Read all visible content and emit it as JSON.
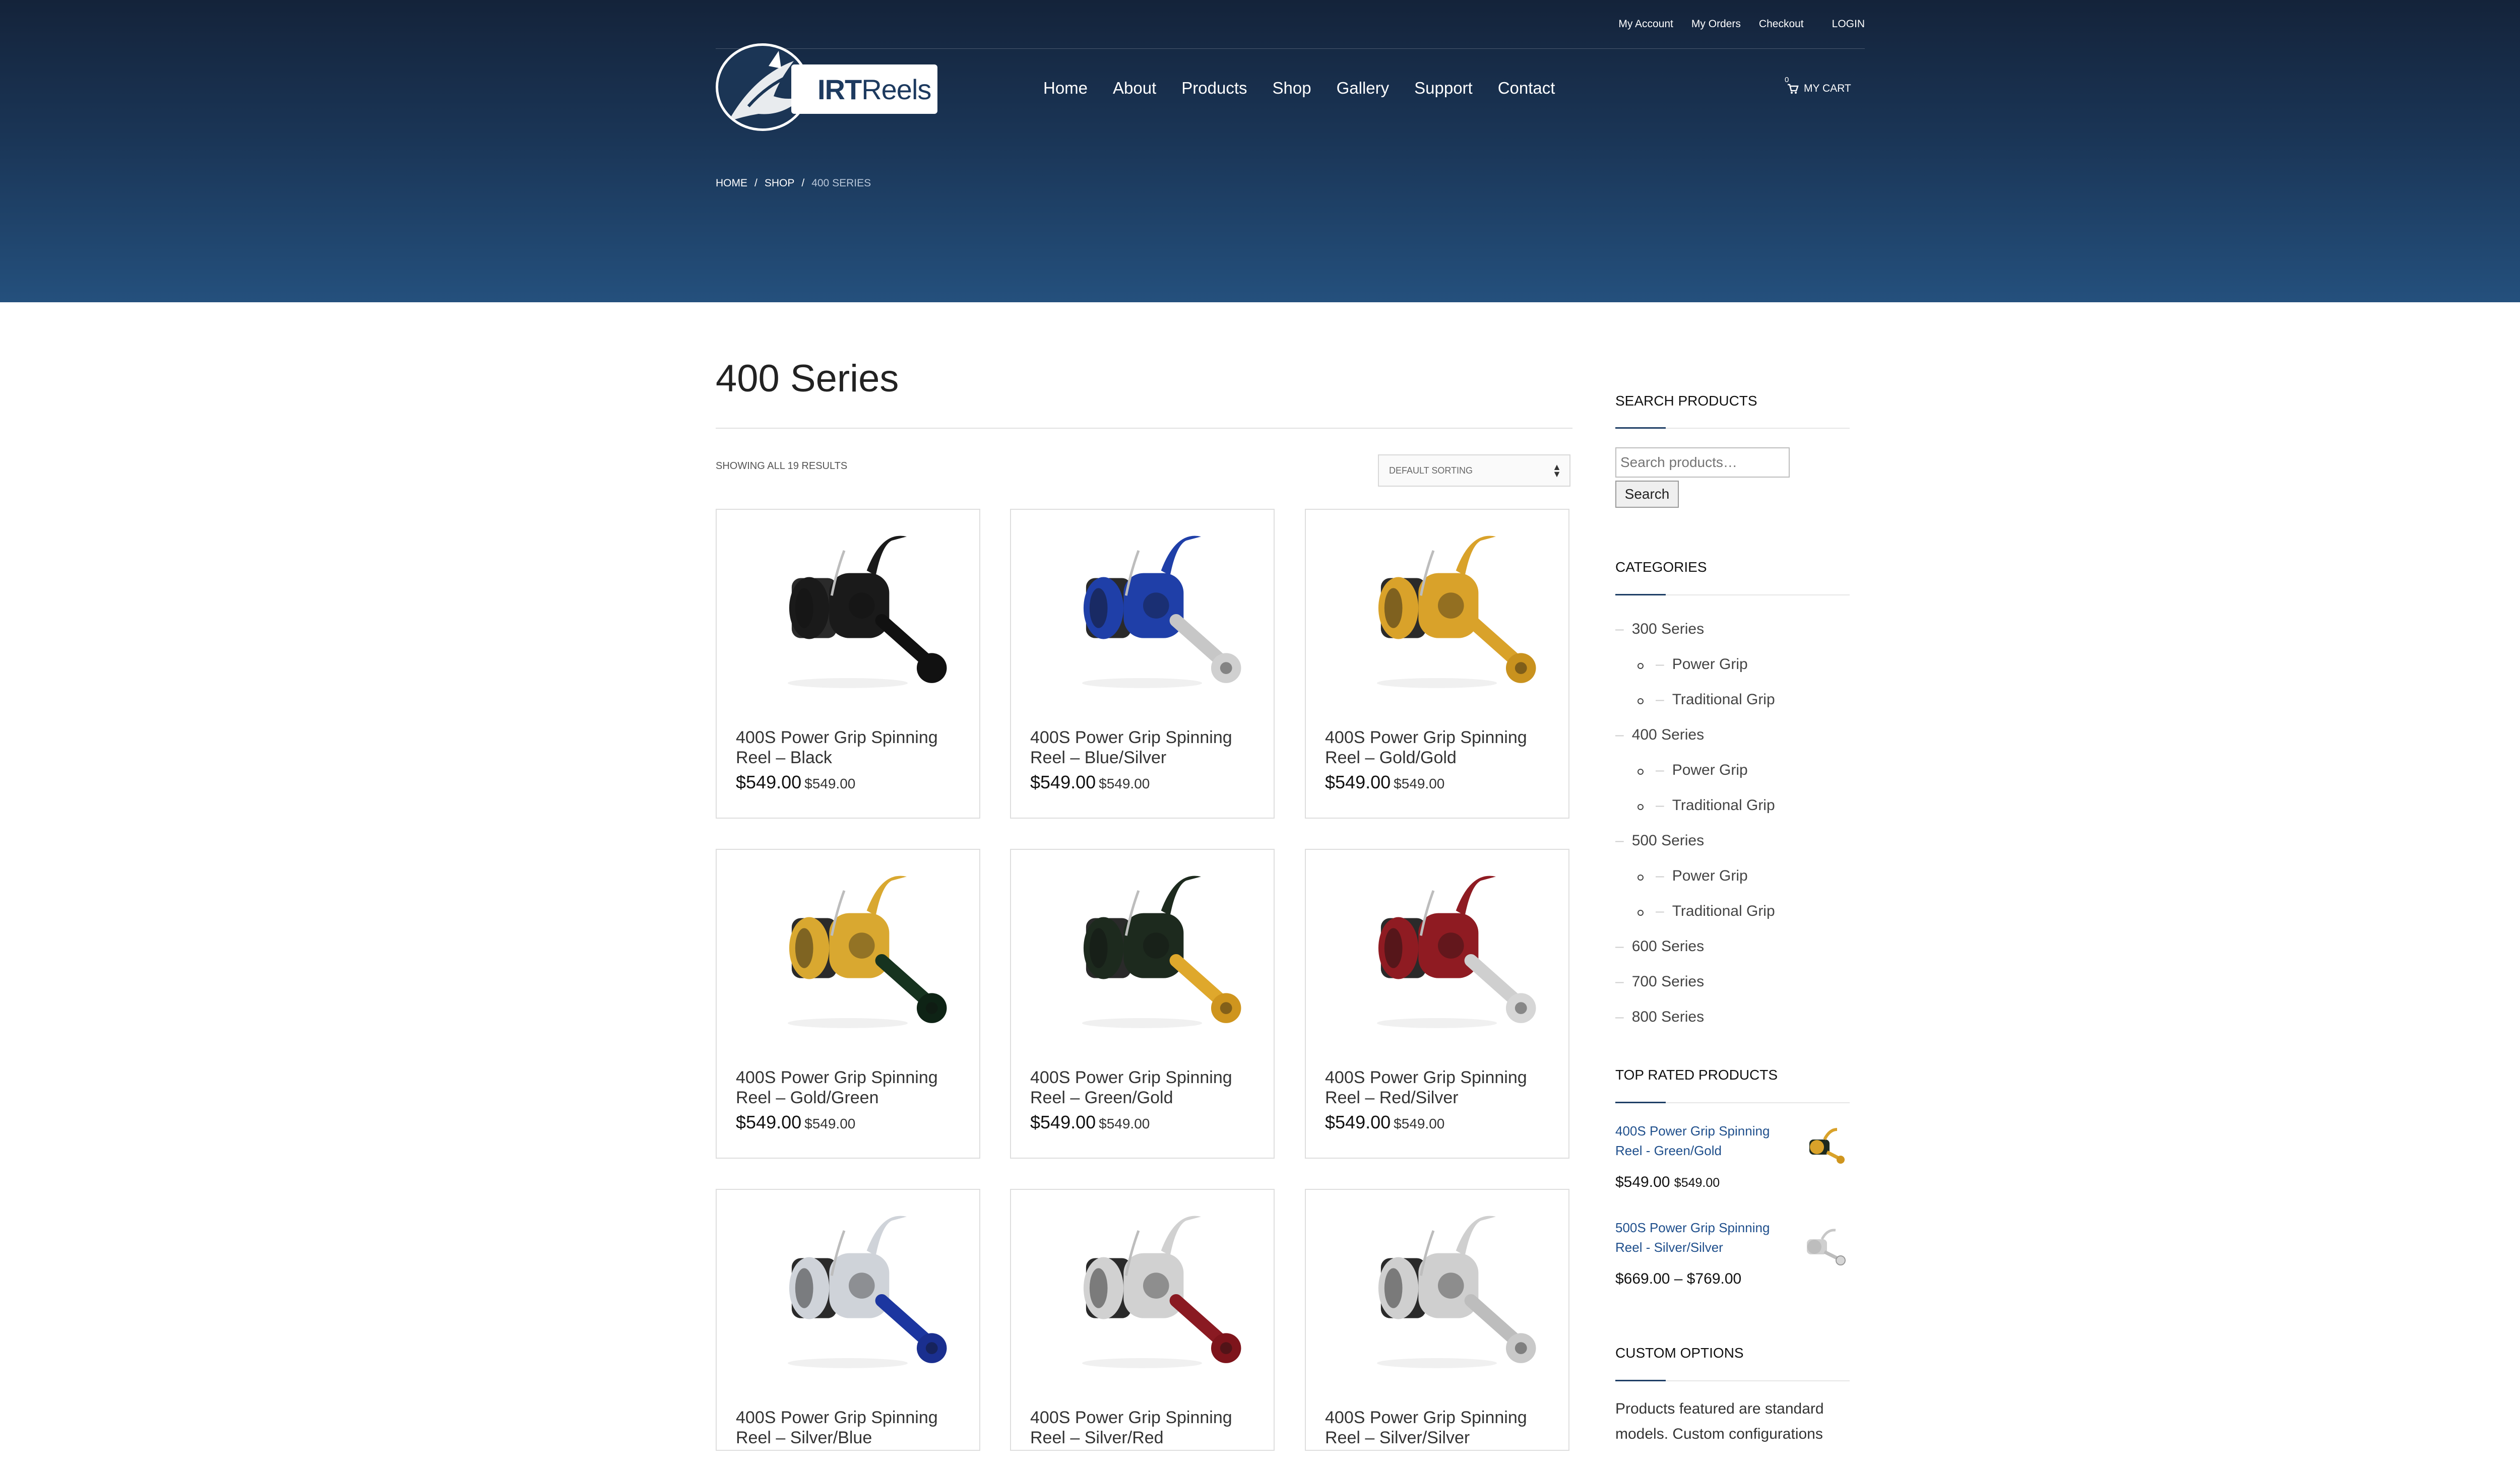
{
  "topbar": {
    "my_account": "My Account",
    "my_orders": "My Orders",
    "checkout": "Checkout",
    "login": "LOGIN"
  },
  "logo": {
    "brand_bold": "IRT",
    "brand_rest": "Reels"
  },
  "nav": {
    "items": [
      "Home",
      "About",
      "Products",
      "Shop",
      "Gallery",
      "Support",
      "Contact"
    ],
    "cart_label": "MY CART",
    "cart_count": "0"
  },
  "breadcrumb": {
    "home": "HOME",
    "shop": "SHOP",
    "current": "400 SERIES",
    "sep": "/"
  },
  "main": {
    "title": "400 Series",
    "result_count": "SHOWING ALL 19 RESULTS",
    "sort_selected": "DEFAULT SORTING"
  },
  "products": [
    {
      "name": "400S Power Grip Spinning Reel – Black",
      "price": "$549.00",
      "price2": "$549.00",
      "body": "#1a1a1a",
      "handle": "#111111",
      "knob": "#111111"
    },
    {
      "name": "400S Power Grip Spinning Reel – Blue/Silver",
      "price": "$549.00",
      "price2": "$549.00",
      "body": "#1f3fa8",
      "handle": "#c7c7c7",
      "knob": "#d0d0d0"
    },
    {
      "name": "400S Power Grip Spinning Reel – Gold/Gold",
      "price": "$549.00",
      "price2": "$549.00",
      "body": "#d9a22a",
      "handle": "#d9a22a",
      "knob": "#c9921e"
    },
    {
      "name": "400S Power Grip Spinning Reel – Gold/Green",
      "price": "$549.00",
      "price2": "$549.00",
      "body": "#d9a830",
      "handle": "#16331f",
      "knob": "#0e2315"
    },
    {
      "name": "400S Power Grip Spinning Reel – Green/Gold",
      "price": "$549.00",
      "price2": "$549.00",
      "body": "#1d2a1e",
      "handle": "#dfa82c",
      "knob": "#cf951e"
    },
    {
      "name": "400S Power Grip Spinning Reel – Red/Silver",
      "price": "$549.00",
      "price2": "$549.00",
      "body": "#8f1b22",
      "handle": "#cfcfcf",
      "knob": "#d6d6d6"
    },
    {
      "name": "400S Power Grip Spinning Reel – Silver/Blue",
      "price": "",
      "price2": "",
      "body": "#cfd3d9",
      "handle": "#1c36a0",
      "knob": "#1a2f8f"
    },
    {
      "name": "400S Power Grip Spinning Reel – Silver/Red",
      "price": "",
      "price2": "",
      "body": "#d1d1d1",
      "handle": "#8a1a22",
      "knob": "#7e141b"
    },
    {
      "name": "400S Power Grip Spinning Reel – Silver/Silver",
      "price": "",
      "price2": "",
      "body": "#cfcfcf",
      "handle": "#bdbdbd",
      "knob": "#c9c9c9"
    }
  ],
  "sidebar": {
    "search_heading": "SEARCH PRODUCTS",
    "search_placeholder": "Search products…",
    "search_button": "Search",
    "categories_heading": "CATEGORIES",
    "categories": [
      {
        "label": "300 Series",
        "sub": [
          "Power Grip",
          "Traditional Grip"
        ]
      },
      {
        "label": "400 Series",
        "sub": [
          "Power Grip",
          "Traditional Grip"
        ]
      },
      {
        "label": "500 Series",
        "sub": [
          "Power Grip",
          "Traditional Grip"
        ]
      },
      {
        "label": "600 Series",
        "sub": []
      },
      {
        "label": "700 Series",
        "sub": []
      },
      {
        "label": "800 Series",
        "sub": []
      }
    ],
    "top_rated_heading": "TOP RATED PRODUCTS",
    "top_rated": [
      {
        "name": "400S Power Grip Spinning Reel - Green/Gold",
        "price": "$549.00",
        "price2": "$549.00"
      },
      {
        "name": "500S Power Grip Spinning Reel - Silver/Silver",
        "price": "$669.00 – $769.00",
        "price2": ""
      }
    ],
    "custom_heading": "CUSTOM OPTIONS",
    "custom_text": "Products featured are standard models. Custom configurations"
  },
  "colors": {
    "header_dark": "#14233a",
    "header_light": "#24507d",
    "link_blue": "#1f4f8c"
  }
}
